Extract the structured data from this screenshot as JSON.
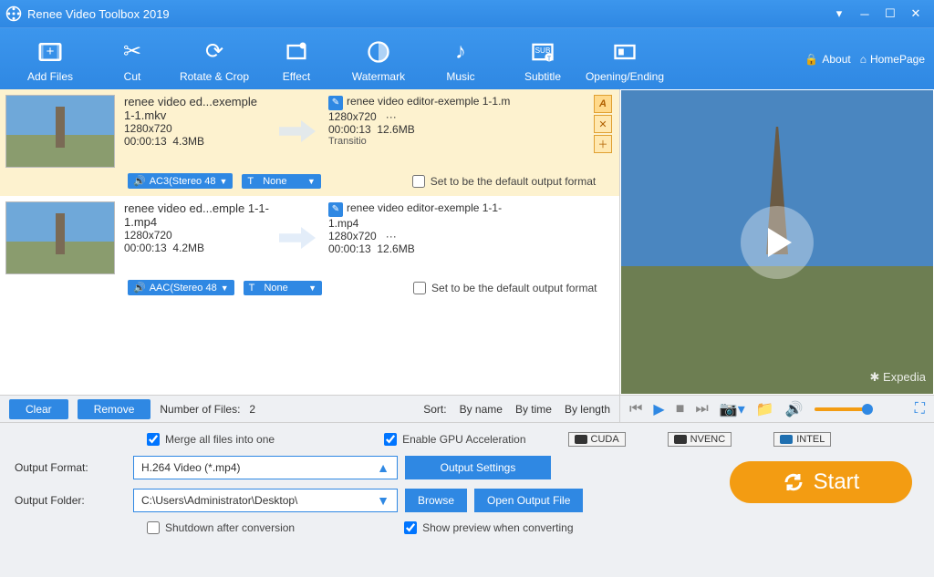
{
  "appTitle": "Renee Video Toolbox 2019",
  "headerLinks": {
    "about": "About",
    "home": "HomePage"
  },
  "toolbar": {
    "addFiles": "Add Files",
    "cut": "Cut",
    "rotateCrop": "Rotate & Crop",
    "effect": "Effect",
    "watermark": "Watermark",
    "music": "Music",
    "subtitle": "Subtitle",
    "openingEnding": "Opening/Ending"
  },
  "files": [
    {
      "in_name": "renee video ed...exemple 1-1.mkv",
      "in_res": "1280x720",
      "in_dur": "00:00:13",
      "in_size": "4.3MB",
      "out_name": "renee video editor-exemple 1-1.m",
      "out_res": "1280x720",
      "out_extra": "···",
      "out_dur": "00:00:13",
      "out_size": "12.6MB",
      "transition": "Transitio",
      "audio": "AC3(Stereo 48",
      "subtitle": "None",
      "defaultLabel": "Set to be the default output format",
      "selected": true
    },
    {
      "in_name": "renee video ed...emple 1-1-1.mp4",
      "in_res": "1280x720",
      "in_dur": "00:00:13",
      "in_size": "4.2MB",
      "out_name": "renee video editor-exemple 1-1-1.mp4",
      "out_res": "1280x720",
      "out_extra": "···",
      "out_dur": "00:00:13",
      "out_size": "12.6MB",
      "transition": "",
      "audio": "AAC(Stereo 48",
      "subtitle": "None",
      "defaultLabel": "Set to be the default output format",
      "selected": false
    }
  ],
  "midbar": {
    "clear": "Clear",
    "remove": "Remove",
    "countLabel": "Number of Files:",
    "count": "2",
    "sortLabel": "Sort:",
    "byName": "By name",
    "byTime": "By time",
    "byLength": "By length"
  },
  "preview": {
    "watermark": "✱ Expedia"
  },
  "bottom": {
    "mergeLabel": "Merge all files into one",
    "gpuLabel": "Enable GPU Acceleration",
    "gpu1": "CUDA",
    "gpu2": "NVENC",
    "gpu3": "INTEL",
    "outFormatLabel": "Output Format:",
    "outFormatValue": "H.264 Video (*.mp4)",
    "outputSettings": "Output Settings",
    "outFolderLabel": "Output Folder:",
    "outFolderValue": "C:\\Users\\Administrator\\Desktop\\",
    "browse": "Browse",
    "openFolder": "Open Output File",
    "shutdownLabel": "Shutdown after conversion",
    "previewLabel": "Show preview when converting",
    "start": "Start"
  }
}
